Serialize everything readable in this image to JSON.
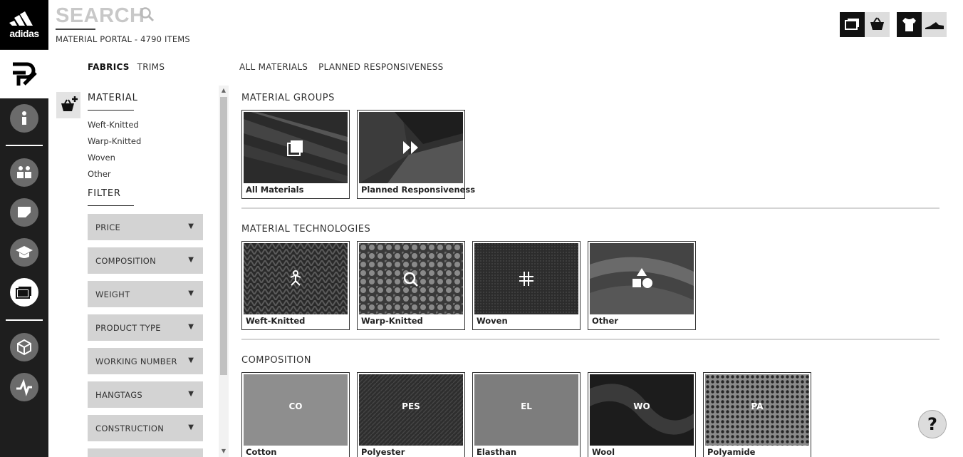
{
  "brand": {
    "name": "adidas"
  },
  "header": {
    "search_label": "SEARCH",
    "portal_count": "MATERIAL PORTAL - 4790 ITEMS"
  },
  "tabs_left": [
    "FABRICS",
    "TRIMS"
  ],
  "tabs_right": [
    "ALL MATERIALS",
    "PLANNED RESPONSIVENESS"
  ],
  "sidebar": {
    "material_heading": "MATERIAL",
    "material_links": [
      "Weft-Knitted",
      "Warp-Knitted",
      "Woven",
      "Other"
    ],
    "filter_heading": "FILTER",
    "filters": [
      "PRICE",
      "COMPOSITION",
      "WEIGHT",
      "PRODUCT TYPE",
      "WORKING NUMBER",
      "HANGTAGS",
      "CONSTRUCTION"
    ]
  },
  "sections": {
    "groups": {
      "title": "MATERIAL GROUPS",
      "cards": [
        {
          "caption": "All Materials",
          "icon": "layers-icon"
        },
        {
          "caption": "Planned Responsiveness",
          "icon": "fast-forward-icon"
        }
      ]
    },
    "technologies": {
      "title": "MATERIAL TECHNOLOGIES",
      "cards": [
        {
          "caption": "Weft-Knitted",
          "icon": "weft-knit-icon"
        },
        {
          "caption": "Warp-Knitted",
          "icon": "warp-knit-icon"
        },
        {
          "caption": "Woven",
          "icon": "woven-icon"
        },
        {
          "caption": "Other",
          "icon": "shapes-icon"
        }
      ]
    },
    "composition": {
      "title": "COMPOSITION",
      "cards": [
        {
          "caption": "Cotton",
          "code": "CO"
        },
        {
          "caption": "Polyester",
          "code": "PES"
        },
        {
          "caption": "Elasthan",
          "code": "EL"
        },
        {
          "caption": "Wool",
          "code": "WO"
        },
        {
          "caption": "Polyamide",
          "code": "PA"
        }
      ]
    }
  },
  "help": {
    "label": "?"
  }
}
